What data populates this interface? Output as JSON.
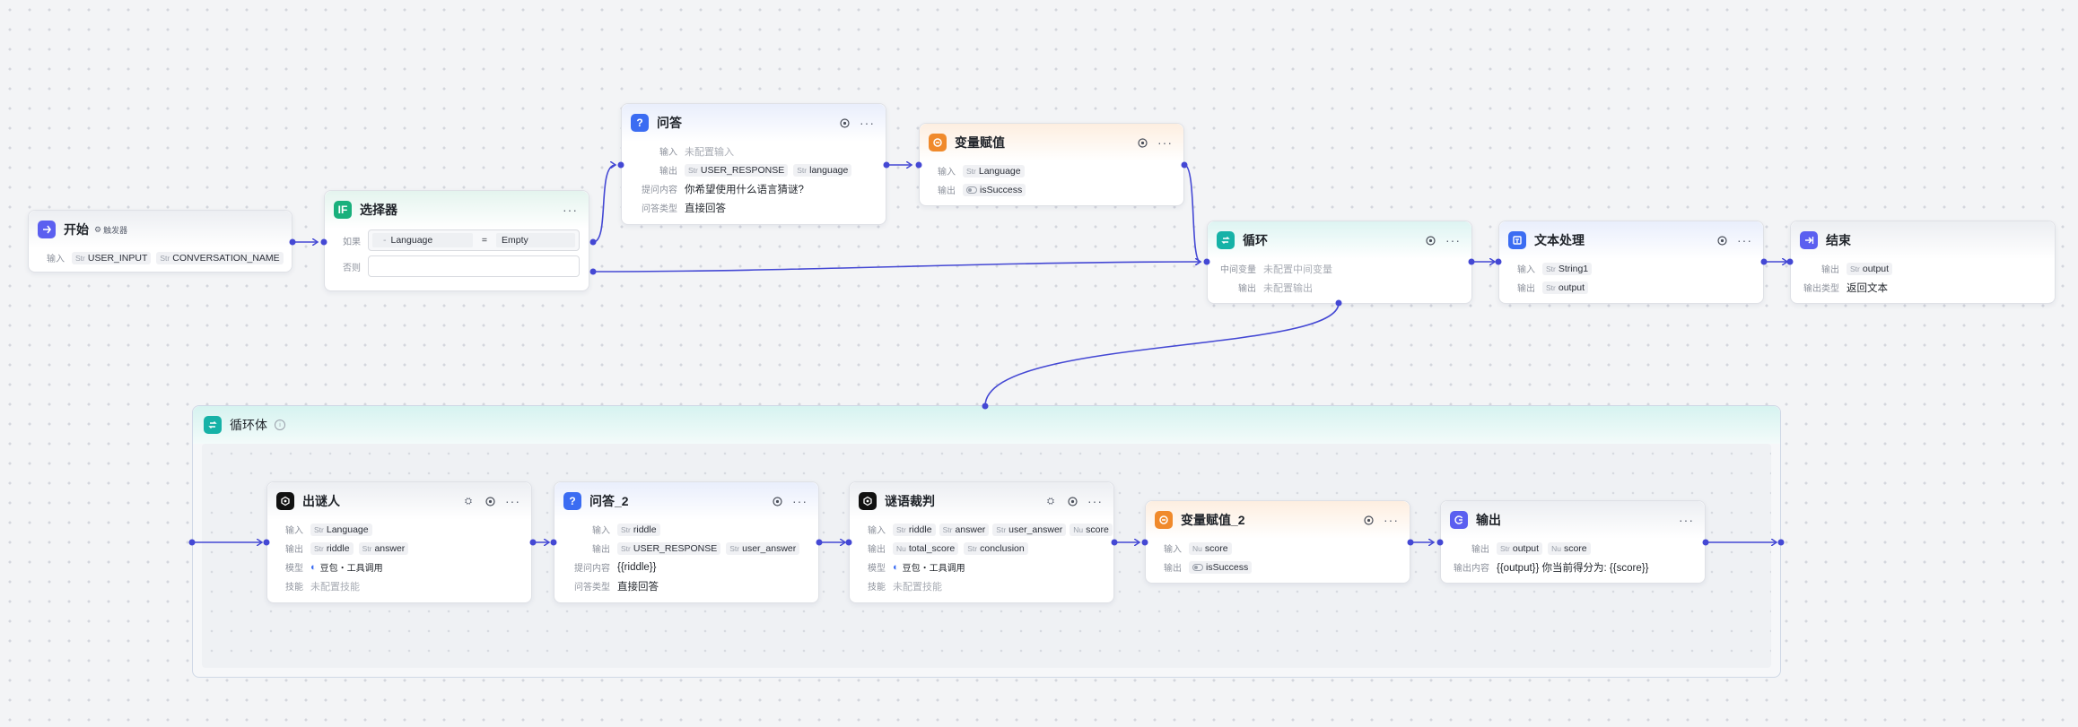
{
  "nodes": {
    "start": {
      "title": "开始",
      "badge": "触发器",
      "input_label": "输入",
      "inputs": [
        {
          "type": "Str",
          "name": "USER_INPUT"
        },
        {
          "type": "Str",
          "name": "CONVERSATION_NAME"
        }
      ]
    },
    "selector": {
      "title": "选择器",
      "if_label": "如果",
      "else_label": "否则",
      "cond_var": "Language",
      "cond_op": "=",
      "cond_val": "Empty"
    },
    "qa": {
      "title": "问答",
      "input_label": "输入",
      "input_value": "未配置输入",
      "output_label": "输出",
      "outputs": [
        {
          "type": "Str",
          "name": "USER_RESPONSE"
        },
        {
          "type": "Str",
          "name": "language"
        }
      ],
      "question_label": "提问内容",
      "question": "你希望使用什么语言猜谜?",
      "qtype_label": "问答类型",
      "qtype": "直接回答"
    },
    "assign": {
      "title": "变量赋值",
      "input_label": "输入",
      "input": {
        "type": "Str",
        "name": "Language"
      },
      "output_label": "输出",
      "output": {
        "name": "isSuccess"
      }
    },
    "loop": {
      "title": "循环",
      "mid_label": "中间变量",
      "mid_value": "未配置中间变量",
      "output_label": "输出",
      "output_value": "未配置输出"
    },
    "text": {
      "title": "文本处理",
      "input_label": "输入",
      "input": {
        "type": "Str",
        "name": "String1"
      },
      "output_label": "输出",
      "output": {
        "type": "Str",
        "name": "output"
      }
    },
    "end": {
      "title": "结束",
      "output_label": "输出",
      "output": {
        "type": "Str",
        "name": "output"
      },
      "otype_label": "输出类型",
      "otype": "返回文本"
    }
  },
  "loop_body": {
    "title": "循环体",
    "info": "i",
    "nodes": {
      "riddler": {
        "title": "出谜人",
        "input_label": "输入",
        "input": {
          "type": "Str",
          "name": "Language"
        },
        "output_label": "输出",
        "outputs": [
          {
            "type": "Str",
            "name": "riddle"
          },
          {
            "type": "Str",
            "name": "answer"
          }
        ],
        "model_label": "模型",
        "model": "豆包・工具调用",
        "skill_label": "技能",
        "skill": "未配置技能"
      },
      "qa2": {
        "title": "问答_2",
        "input_label": "输入",
        "input": {
          "type": "Str",
          "name": "riddle"
        },
        "output_label": "输出",
        "outputs": [
          {
            "type": "Str",
            "name": "USER_RESPONSE"
          },
          {
            "type": "Str",
            "name": "user_answer"
          }
        ],
        "question_label": "提问内容",
        "question": "{{riddle}}",
        "qtype_label": "问答类型",
        "qtype": "直接回答"
      },
      "judge": {
        "title": "谜语裁判",
        "input_label": "输入",
        "inputs": [
          {
            "type": "Str",
            "name": "riddle"
          },
          {
            "type": "Str",
            "name": "answer"
          },
          {
            "type": "Str",
            "name": "user_answer"
          },
          {
            "type": "Nu",
            "name": "score"
          }
        ],
        "output_label": "输出",
        "outputs": [
          {
            "type": "Nu",
            "name": "total_score"
          },
          {
            "type": "Str",
            "name": "conclusion"
          }
        ],
        "model_label": "模型",
        "model": "豆包・工具调用",
        "skill_label": "技能",
        "skill": "未配置技能"
      },
      "assign2": {
        "title": "变量赋值_2",
        "input_label": "输入",
        "input": {
          "type": "Nu",
          "name": "score"
        },
        "output_label": "输出",
        "output": {
          "name": "isSuccess"
        }
      },
      "output": {
        "title": "输出",
        "output_label": "输出",
        "outputs": [
          {
            "type": "Str",
            "name": "output"
          },
          {
            "type": "Nu",
            "name": "score"
          }
        ],
        "content_label": "输出内容",
        "content": "{{output}} 你当前得分为: {{score}}"
      }
    }
  },
  "colors": {
    "edge": "#4448d4",
    "accent": "#5b5ff0"
  }
}
